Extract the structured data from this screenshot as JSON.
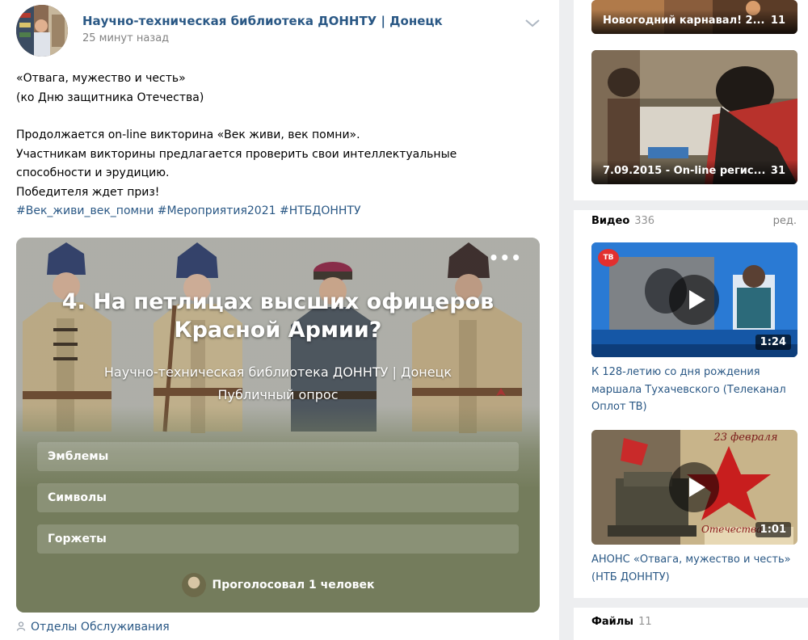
{
  "post": {
    "author": "Научно-техническая библиотека ДОННТУ | Донецк",
    "time": "25 минут назад",
    "lines": [
      "«Отвага, мужество и честь»",
      "(ко Дню защитника Отечества)",
      "Продолжается on-line викторина «Век живи, век помни».",
      "Участникам викторины предлагается проверить свои интеллектуальные",
      "способности и эрудицию.",
      "Победителя ждет приз!"
    ],
    "hashtags": [
      "#Век_живи_век_помни",
      "#Мероприятия2021",
      "#НТБДОННТУ"
    ],
    "signer": "Отделы Обслуживания"
  },
  "poll": {
    "more": "•••",
    "title_line1": "4. На петлицах высших офицеров",
    "title_line2": "Красной Армии?",
    "author": "Научно-техническая библиотека ДОННТУ | Донецк",
    "type": "Публичный опрос",
    "options": [
      "Эмблемы",
      "Символы",
      "Горжеты"
    ],
    "voted_prefix": "Проголосовал",
    "voted_count": "1 человек"
  },
  "sidebar": {
    "albums": [
      {
        "name": "Новогодний карнавал! 2...",
        "count": "11"
      },
      {
        "name": "7.09.2015 - On-line регис...",
        "count": "31"
      }
    ],
    "videos_label": "Видео",
    "videos_count": "336",
    "videos_edit": "ред.",
    "videos": [
      {
        "duration": "1:24",
        "title": "К 128-летию со дня рождения маршала Тухачевского (Телеканал Оплот ТВ)",
        "badge": "ТВ"
      },
      {
        "duration": "1:01",
        "title": "АНОНС «Отвага, мужество и честь» (НТБ ДОННТУ)",
        "overlay": "23 февраля",
        "overlay2": "Отечества"
      }
    ],
    "files_label": "Файлы",
    "files_count": "11"
  }
}
